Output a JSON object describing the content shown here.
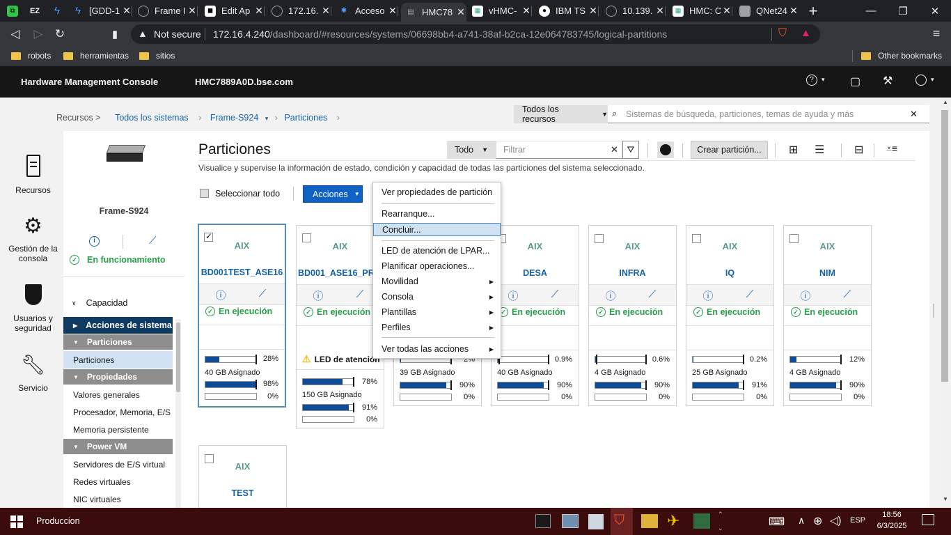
{
  "browser": {
    "tabs": [
      {
        "title": "",
        "fav": "x",
        "color": "#36c14a"
      },
      {
        "title": "",
        "fav": "ez",
        "color": "#fff"
      },
      {
        "title": "",
        "fav": "bolt",
        "color": "#4e9cff"
      },
      {
        "title": "[GDD-1",
        "fav": "bolt",
        "color": "#4e9cff"
      },
      {
        "title": "Frame I",
        "fav": "globe",
        "color": "#9aa0a6"
      },
      {
        "title": "Edit Ap",
        "fav": "mask",
        "color": "#fff"
      },
      {
        "title": "172.16.",
        "fav": "globe",
        "color": "#9aa0a6"
      },
      {
        "title": "Acceso",
        "fav": "ibm",
        "color": "#4e9cff"
      },
      {
        "title": "HMC78",
        "fav": "hmc",
        "color": "#9aa0a6"
      },
      {
        "title": "vHMC-",
        "fav": "img",
        "color": "#fff"
      },
      {
        "title": "IBM TS",
        "fav": "ibm2",
        "color": "#fff"
      },
      {
        "title": "10.139.",
        "fav": "globe",
        "color": "#9aa0a6"
      },
      {
        "title": "HMC: C",
        "fav": "img",
        "color": "#fff"
      },
      {
        "title": "QNet24",
        "fav": "q",
        "color": "#9aa0a6"
      }
    ],
    "not_secure": "Not secure",
    "url_host": "172.16.4.240",
    "url_path": "/dashboard/#resources/systems/06698bb4-a741-38af-b2ca-12e064783745/logical-partitions",
    "bookmarks": [
      "robots",
      "herramientas",
      "sitios"
    ],
    "other_bookmarks": "Other bookmarks"
  },
  "header": {
    "app_title": "Hardware Management Console",
    "host": "HMC7889A0D.bse.com"
  },
  "breadcrumb": {
    "root": "Recursos >",
    "all": "Todos los sistemas",
    "frame": "Frame-S924",
    "current": "Particiones"
  },
  "search": {
    "scope": "Todos los recursos",
    "placeholder": "Sistemas de búsqueda, particiones, temas de ayuda y más"
  },
  "rail": [
    {
      "label": "Recursos"
    },
    {
      "label": "Gestión de la consola"
    },
    {
      "label": "Usuarios y seguridad"
    },
    {
      "label": "Servicio"
    }
  ],
  "system": {
    "name": "Frame-S924",
    "status": "En funcionamiento"
  },
  "leftnav": {
    "capacidad": "Capacidad",
    "acciones": "Acciones de sistema",
    "sec_particiones": "Particiones",
    "particiones": "Particiones",
    "sec_propiedades": "Propiedades",
    "valores": "Valores generales",
    "procesador": "Procesador, Memoria, E/S",
    "memoria": "Memoria persistente",
    "sec_powervm": "Power VM",
    "servidores": "Servidores de E/S virtual",
    "redes": "Redes virtuales",
    "nic": "NIC virtuales"
  },
  "main": {
    "title": "Particiones",
    "subtitle": "Visualice y supervise la información de estado, condición y capacidad de todas las particiones del sistema seleccionado.",
    "filter_scope": "Todo",
    "filter_placeholder": "Filtrar",
    "create_button": "Crear partición...",
    "select_all": "Seleccionar todo",
    "actions_button": "Acciones"
  },
  "partitions": [
    {
      "os": "AIX",
      "name": "BD001TEST_ASE16",
      "status": "En ejecución",
      "cpu": "28%",
      "cpu_val": 0.28,
      "mem": "40 GB Asignado",
      "mem_pct": "98%",
      "mem_val": 0.98,
      "io": "0%",
      "io_val": 0
    },
    {
      "os": "AIX",
      "name": "BD001_ASE16_PROD",
      "status": "En ejecución",
      "led": "LED de atención",
      "cpu": "78%",
      "cpu_val": 0.78,
      "mem": "150 GB Asignado",
      "mem_pct": "91%",
      "mem_val": 0.91,
      "io": "0%",
      "io_val": 0
    },
    {
      "os": "AIX",
      "name": "",
      "status": "",
      "cpu": "2%",
      "cpu_val": 0.02,
      "mem": "39 GB Asignado",
      "mem_pct": "90%",
      "mem_val": 0.9,
      "io": "0%",
      "io_val": 0
    },
    {
      "os": "AIX",
      "name": "DESA",
      "status": "En ejecución",
      "cpu": "0.9%",
      "cpu_val": 0.009,
      "mem": "40 GB Asignado",
      "mem_pct": "90%",
      "mem_val": 0.9,
      "io": "0%",
      "io_val": 0
    },
    {
      "os": "AIX",
      "name": "INFRA",
      "status": "En ejecución",
      "cpu": "0.6%",
      "cpu_val": 0.006,
      "mem": "4 GB Asignado",
      "mem_pct": "90%",
      "mem_val": 0.9,
      "io": "0%",
      "io_val": 0
    },
    {
      "os": "AIX",
      "name": "IQ",
      "status": "En ejecución",
      "cpu": "0.2%",
      "cpu_val": 0.002,
      "mem": "25 GB Asignado",
      "mem_pct": "91%",
      "mem_val": 0.91,
      "io": "0%",
      "io_val": 0
    },
    {
      "os": "AIX",
      "name": "NIM",
      "status": "En ejecución",
      "cpu": "12%",
      "cpu_val": 0.12,
      "mem": "4 GB Asignado",
      "mem_pct": "90%",
      "mem_val": 0.9,
      "io": "0%",
      "io_val": 0
    },
    {
      "os": "AIX",
      "name": "TEST"
    }
  ],
  "menu": [
    {
      "label": "Ver propiedades de partición"
    },
    {
      "label": "Rearranque..."
    },
    {
      "label": "Concluir..."
    },
    {
      "label": "LED de atención de LPAR..."
    },
    {
      "label": "Planificar operaciones..."
    },
    {
      "label": "Movilidad"
    },
    {
      "label": "Consola"
    },
    {
      "label": "Plantillas"
    },
    {
      "label": "Perfiles"
    },
    {
      "label": "Ver todas las acciones"
    }
  ],
  "taskbar": {
    "window": "Produccion",
    "lang": "ESP",
    "time": "18:56",
    "date": "6/3/2025"
  }
}
